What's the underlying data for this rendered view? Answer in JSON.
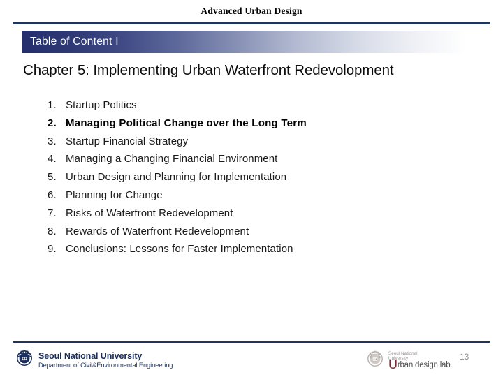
{
  "deck": {
    "title": "Advanced Urban Design"
  },
  "banner": {
    "label": "Table of Content I",
    "gradient_start": "#262f6e",
    "gradient_end": "#ffffff"
  },
  "chapter": {
    "heading": "Chapter 5: Implementing Urban Waterfront Redevolopment"
  },
  "contents": {
    "items": [
      {
        "number": "1.",
        "label": "Startup Politics",
        "current": false
      },
      {
        "number": "2.",
        "label": "Managing Political Change over the Long Term",
        "current": true
      },
      {
        "number": "3.",
        "label": "Startup Financial Strategy",
        "current": false
      },
      {
        "number": "4.",
        "label": "Managing a Changing Financial Environment",
        "current": false
      },
      {
        "number": "5.",
        "label": "Urban Design and Planning for Implementation",
        "current": false
      },
      {
        "number": "6.",
        "label": "Planning for Change",
        "current": false
      },
      {
        "number": "7.",
        "label": "Risks of Waterfront Redevelopment",
        "current": false
      },
      {
        "number": "8.",
        "label": "Rewards of Waterfront Redevelopment",
        "current": false
      },
      {
        "number": "9.",
        "label": "Conclusions: Lessons for Faster Implementation",
        "current": false
      }
    ]
  },
  "footer": {
    "rule_color": "#20355e",
    "left": {
      "crest_icon": "snu-crest-icon",
      "university": "Seoul National University",
      "department": "Department of Civil&Environmental Engineering",
      "color": "#1b2f5e"
    },
    "right": {
      "crest_icon": "snu-crest-watermark-icon",
      "lab_university_line1": "Seoul National",
      "lab_university_line2": "University",
      "lab_initial": "U",
      "lab_name": "rban design lab.",
      "lab_initial_color": "#7a2b37"
    },
    "page_number": "13"
  }
}
